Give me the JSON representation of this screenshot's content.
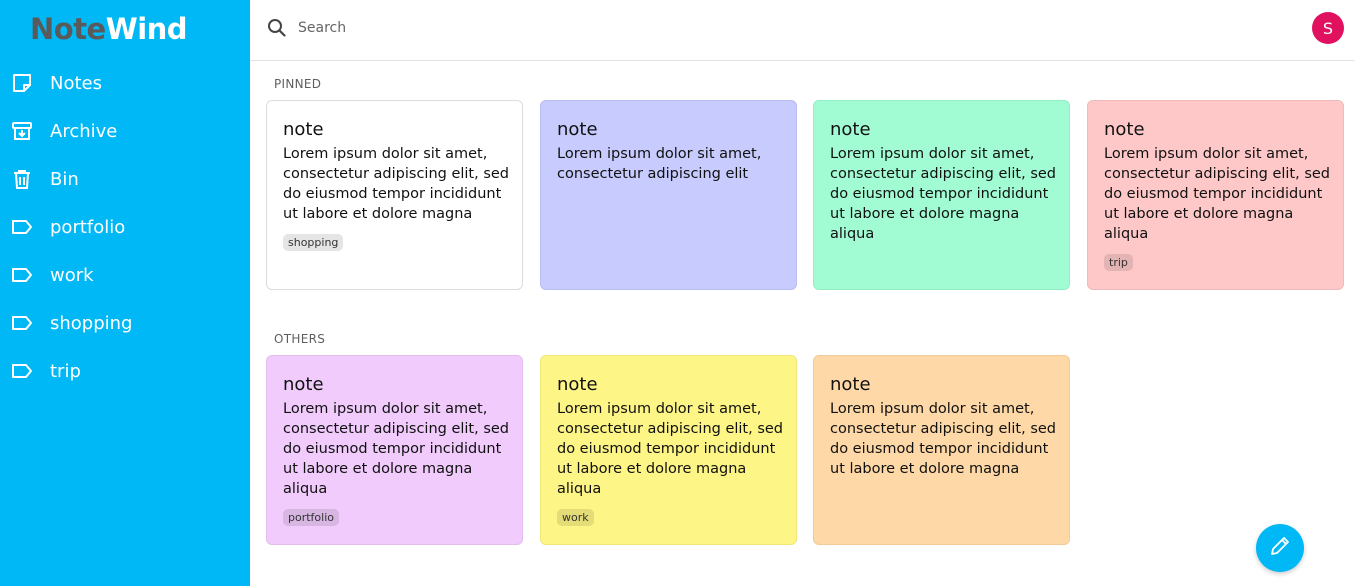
{
  "app": {
    "logo_part1": "Note",
    "logo_part2": "Wind",
    "accent_color": "#00b8f5"
  },
  "sidebar": {
    "items": [
      {
        "label": "Notes",
        "icon": "note-icon"
      },
      {
        "label": "Archive",
        "icon": "archive-icon"
      },
      {
        "label": "Bin",
        "icon": "trash-icon"
      },
      {
        "label": "portfolio",
        "icon": "label-icon"
      },
      {
        "label": "work",
        "icon": "label-icon"
      },
      {
        "label": "shopping",
        "icon": "label-icon"
      },
      {
        "label": "trip",
        "icon": "label-icon"
      }
    ]
  },
  "header": {
    "search_placeholder": "Search",
    "avatar_initial": "S",
    "avatar_color": "#e0115f"
  },
  "pinned": {
    "title": "PINNED",
    "notes": [
      {
        "title": "note",
        "body": "Lorem ipsum dolor sit amet, consectetur adipiscing elit, sed do eiusmod tempor incididunt ut labore et dolore magna",
        "tag": "shopping",
        "color": "#ffffff"
      },
      {
        "title": "note",
        "body": "Lorem ipsum dolor sit amet, consectetur adipiscing elit",
        "tag": "",
        "color": "#c7cbfd"
      },
      {
        "title": "note",
        "body": "Lorem ipsum dolor sit amet, consectetur adipiscing elit, sed do eiusmod tempor incididunt ut labore et dolore magna aliqua",
        "tag": "",
        "color": "#a1fcd4"
      },
      {
        "title": "note",
        "body": "Lorem ipsum dolor sit amet, consectetur adipiscing elit, sed do eiusmod tempor incididunt ut labore et dolore magna aliqua",
        "tag": "trip",
        "color": "#fec8c8"
      }
    ]
  },
  "others": {
    "title": "OTHERS",
    "notes": [
      {
        "title": "note",
        "body": "Lorem ipsum dolor sit amet, consectetur adipiscing elit, sed do eiusmod tempor incididunt ut labore et dolore magna aliqua",
        "tag": "portfolio",
        "color": "#f0cbfc"
      },
      {
        "title": "note",
        "body": "Lorem ipsum dolor sit amet, consectetur adipiscing elit, sed do eiusmod tempor incididunt ut labore et dolore magna aliqua",
        "tag": "work",
        "color": "#fdf585"
      },
      {
        "title": "note",
        "body": "Lorem ipsum dolor sit amet, consectetur adipiscing elit, sed do eiusmod tempor incididunt ut labore et dolore magna",
        "tag": "",
        "color": "#fed8a7"
      }
    ]
  },
  "fab": {
    "icon": "pencil-icon"
  }
}
